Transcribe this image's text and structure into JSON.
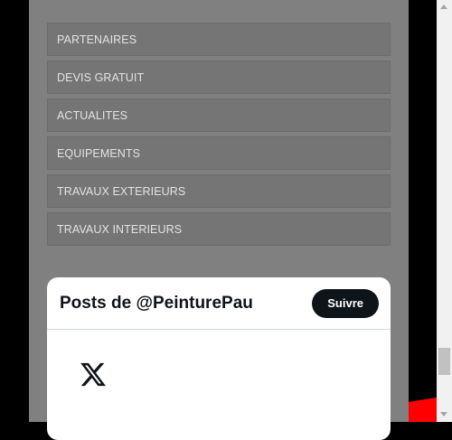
{
  "menu": {
    "items": [
      {
        "label": "PARTENAIRES"
      },
      {
        "label": "DEVIS GRATUIT"
      },
      {
        "label": "ACTUALITES"
      },
      {
        "label": "EQUIPEMENTS"
      },
      {
        "label": "TRAVAUX EXTERIEURS"
      },
      {
        "label": "TRAVAUX INTERIEURS"
      }
    ]
  },
  "twitter_widget": {
    "title": "Posts de @PeinturePau",
    "follow_label": "Suivre",
    "logo_icon": "x-logo-icon"
  },
  "colors": {
    "page_panel": "#808080",
    "menu_item_bg": "#757575",
    "menu_text": "#e3e3e3",
    "follow_button": "#0f1419",
    "accent_red": "#ff0000"
  }
}
